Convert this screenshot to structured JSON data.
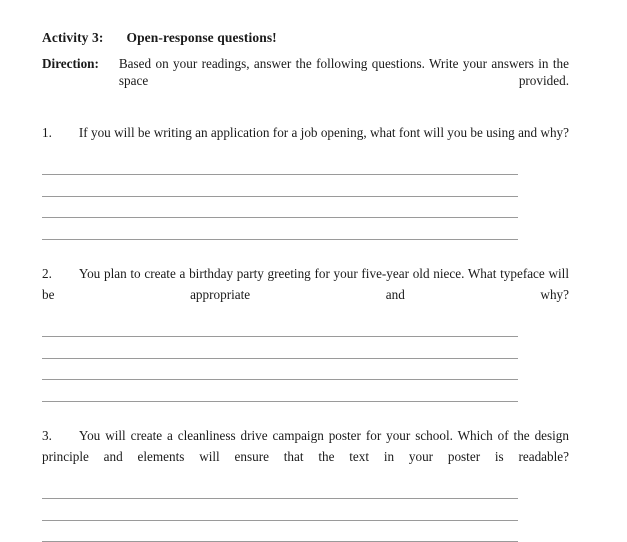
{
  "document": {
    "activity": {
      "label": "Activity 3:",
      "title": "Open-response questions!"
    },
    "direction": {
      "label": "Direction:",
      "text": "Based on your readings, answer the following questions. Write your answers in the space provided."
    },
    "questions": [
      {
        "number": "1.",
        "text": "If you will be writing an application for a job opening, what font will you be using and why?",
        "answer_line_count": 4
      },
      {
        "number": "2.",
        "text": "You plan to create a birthday party greeting for your five-year old niece. What typeface will be appropriate and why?",
        "answer_line_count": 4
      },
      {
        "number": "3.",
        "text": "You will create a cleanliness drive campaign poster for your school. Which of the design principle and elements will ensure that the text in your poster is readable?",
        "answer_line_count": 3
      }
    ]
  },
  "colors": {
    "page_background": "#ffffff",
    "text": "#1a1a1a",
    "answer_rule": "#9a9a9a"
  }
}
